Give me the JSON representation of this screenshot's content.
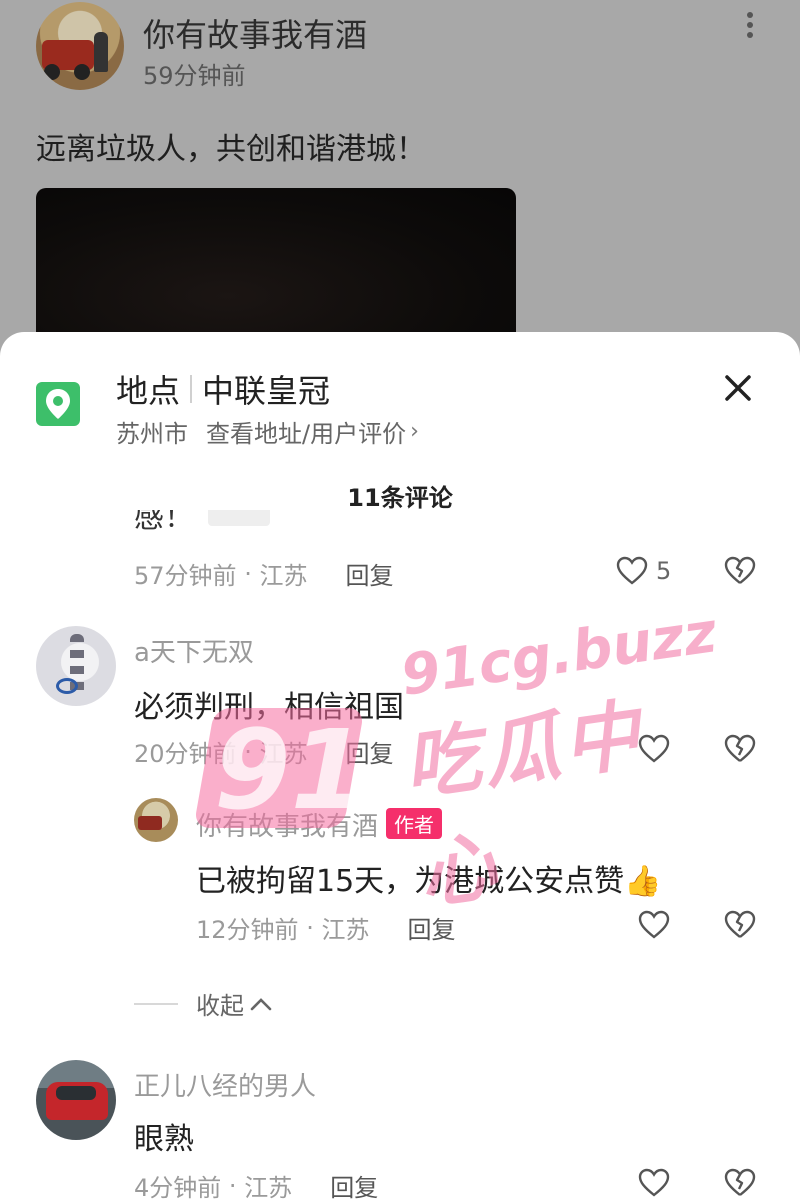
{
  "post": {
    "author": "你有故事我有酒",
    "time": "59分钟前",
    "text": "远离垃圾人，共创和谐港城！"
  },
  "location": {
    "label": "地点",
    "name": "中联皇冠",
    "city": "苏州市",
    "link": "查看地址/用户评价",
    "icon": "location-pin-icon"
  },
  "comments_header": {
    "count_label": "11条评论"
  },
  "clipped_comment": {
    "text": "感！",
    "time": "57分钟前",
    "region": "江苏",
    "reply_label": "回复",
    "likes": "5"
  },
  "comments": [
    {
      "user": "a天下无双",
      "text": "必须判刑，相信祖国",
      "time": "20分钟前",
      "region": "江苏",
      "reply_label": "回复"
    },
    {
      "user": "你有故事我有酒",
      "badge": "作者",
      "text": "已被拘留15天，为港城公安点赞",
      "emoji": "👍",
      "time": "12分钟前",
      "region": "江苏",
      "reply_label": "回复"
    },
    {
      "user": "正儿八经的男人",
      "text": "眼熟",
      "time": "4分钟前",
      "region": "江苏",
      "reply_label": "回复"
    }
  ],
  "collapse_label": "收起",
  "meta_sep": "·",
  "watermark": {
    "number": "91",
    "domain": "91cg.buzz",
    "text": "吃瓜中心"
  },
  "colors": {
    "accent": "#f52f6b",
    "location_green": "#3dbf6a"
  }
}
